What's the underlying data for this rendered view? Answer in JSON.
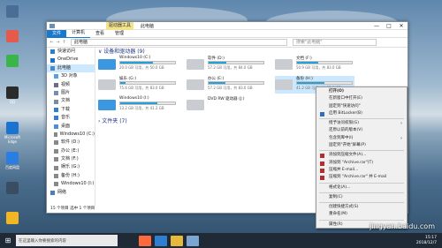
{
  "desktop": {
    "icons": [
      {
        "label": "",
        "color": "#4a6d95"
      },
      {
        "label": "",
        "color": "#e55a4a"
      },
      {
        "label": "",
        "color": "#39b549"
      },
      {
        "label": "QQ",
        "color": "#2b2b2b"
      },
      {
        "label": "Microsoft Edge",
        "color": "#1a74cf"
      },
      {
        "label": "百度网盘",
        "color": "#2a7de1"
      },
      {
        "label": "",
        "color": "#3a4e63"
      },
      {
        "label": "",
        "color": "#f2b624"
      }
    ]
  },
  "window": {
    "manage_tab": "驱动器工具",
    "title": "此电脑",
    "controls": {
      "minimize": "—",
      "maximize": "□",
      "close": "✕"
    },
    "ribbon": {
      "file": "文件",
      "computer": "计算机",
      "view": "查看",
      "manage": "管理"
    },
    "address": {
      "back": "←",
      "forward": "→",
      "up": "↑",
      "path": "此电脑",
      "search_placeholder": "搜索\"此电脑\""
    },
    "sidebar": [
      {
        "label": "快速访问",
        "color": "#2b7cd3",
        "selected": false,
        "indent": false
      },
      {
        "label": "OneDrive",
        "color": "#1d6fc9",
        "selected": false,
        "indent": false
      },
      {
        "label": "此电脑",
        "color": "#4d87c7",
        "selected": true,
        "indent": false
      },
      {
        "label": "3D 对象",
        "color": "#5aa0e0",
        "selected": false,
        "indent": true
      },
      {
        "label": "视频",
        "color": "#6b6b8a",
        "selected": false,
        "indent": true
      },
      {
        "label": "图片",
        "color": "#6c8fb5",
        "selected": false,
        "indent": true
      },
      {
        "label": "文档",
        "color": "#7a8ba0",
        "selected": false,
        "indent": true
      },
      {
        "label": "下载",
        "color": "#2f7fd0",
        "selected": false,
        "indent": true
      },
      {
        "label": "音乐",
        "color": "#3d7bc8",
        "selected": false,
        "indent": true
      },
      {
        "label": "桌面",
        "color": "#4a90d9",
        "selected": false,
        "indent": true
      },
      {
        "label": "Windows10 (C:)",
        "color": "#888",
        "selected": false,
        "indent": true
      },
      {
        "label": "软件 (D:)",
        "color": "#888",
        "selected": false,
        "indent": true
      },
      {
        "label": "办公 (E:)",
        "color": "#888",
        "selected": false,
        "indent": true
      },
      {
        "label": "文档 (F:)",
        "color": "#888",
        "selected": false,
        "indent": true
      },
      {
        "label": "娱乐 (G:)",
        "color": "#888",
        "selected": false,
        "indent": true
      },
      {
        "label": "备份 (H:)",
        "color": "#888",
        "selected": false,
        "indent": true
      },
      {
        "label": "Windows10 (I:)",
        "color": "#888",
        "selected": false,
        "indent": true
      },
      {
        "label": "网络",
        "color": "#4a7fb5",
        "selected": false,
        "indent": false
      }
    ],
    "devices_header": "∨ 设备和驱动器 (9)",
    "folders_header": "› 文件夹 (7)",
    "drives": [
      {
        "label": "Windows10 (C:)",
        "free": "20.0 GB 可用，共 50.0 GB",
        "used": 0.6,
        "win": true,
        "selected": false
      },
      {
        "label": "软件 (D:)",
        "free": "57.2 GB 可用，共 84.0 GB",
        "used": 0.32,
        "win": false,
        "selected": false
      },
      {
        "label": "文档 (F:)",
        "free": "50.9 GB 可用，共 83.0 GB",
        "used": 0.39,
        "win": false,
        "selected": false
      },
      {
        "label": "娱乐 (G:)",
        "free": "75.6 GB 可用，共 83.0 GB",
        "used": 0.09,
        "win": false,
        "selected": false
      },
      {
        "label": "办公 (E:)",
        "free": "57.2 GB 可用，共 83.0 GB",
        "used": 0.31,
        "win": false,
        "selected": false
      },
      {
        "label": "备份 (H:)",
        "free": "41.2 GB 可用，共 83.0 GB",
        "used": 0.5,
        "win": false,
        "selected": true
      },
      {
        "label": "Windows10 (I:)",
        "free": "13.2 GB 可用，共 41.2 GB",
        "used": 0.68,
        "win": true,
        "selected": false
      },
      {
        "label": "DVD RW 驱动器 (J:)",
        "free": "",
        "used": null,
        "win": false,
        "selected": false
      }
    ],
    "status": "15 个项目  选中 1 个项目"
  },
  "context_menu": [
    {
      "label": "打开(O)",
      "bold": true
    },
    {
      "label": "在新窗口中打开(E)"
    },
    {
      "label": "固定到\"快速访问\""
    },
    {
      "label": "启用 BitLocker(B)",
      "icon": "#2d6fb8"
    },
    {
      "sep": true
    },
    {
      "label": "授予访问权限(G)",
      "arrow": true
    },
    {
      "label": "还原以前的版本(V)"
    },
    {
      "label": "包含到库中(I)",
      "arrow": true
    },
    {
      "label": "固定到\"开始\"屏幕(P)"
    },
    {
      "sep": true
    },
    {
      "label": "添加到压缩文件(A)...",
      "icon": "#b22d2d"
    },
    {
      "label": "添加到 \"Archive.rar\"(T)",
      "icon": "#b22d2d"
    },
    {
      "label": "压缩并 E-mail...",
      "icon": "#b22d2d"
    },
    {
      "label": "压缩到 \"Archive.rar\" 并 E-mail",
      "icon": "#b22d2d"
    },
    {
      "sep": true
    },
    {
      "label": "格式化(A)..."
    },
    {
      "sep": true
    },
    {
      "label": "复制(C)"
    },
    {
      "sep": true
    },
    {
      "label": "创建快捷方式(S)"
    },
    {
      "label": "重命名(M)"
    },
    {
      "sep": true
    },
    {
      "label": "属性(R)"
    }
  ],
  "taskbar": {
    "start": "⊞",
    "search": "在这里输入你要搜索的内容",
    "time": "15:17",
    "date": "2018/12/7",
    "apps": [
      "#ff6a3d",
      "#2e7fd0",
      "#e6b93a",
      "#7ba6d3"
    ]
  },
  "watermark": "jingyan.baidu.com"
}
